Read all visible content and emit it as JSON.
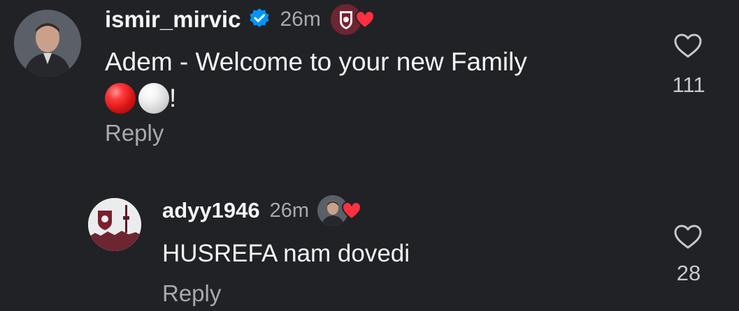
{
  "comments": [
    {
      "username": "ismir_mirvic",
      "time": "26m",
      "text_line1": "Adem - Welcome to your new Family",
      "text_line2_suffix": "!",
      "reply_label": "Reply",
      "like_count": "111"
    },
    {
      "username": "adyy1946",
      "time": "26m",
      "text_line1": "HUSREFA nam dovedi",
      "reply_label": "Reply",
      "like_count": "28"
    }
  ],
  "colors": {
    "background": "#212226",
    "primary_text": "#f5f5f5",
    "secondary_text": "#a8a8ae",
    "verified_blue": "#0095f6",
    "heart_red": "#ff3040",
    "club_maroon": "#7a1f2b"
  },
  "icons": {
    "verified": "verified-badge-icon",
    "like": "heart-outline-icon",
    "liked_by_creator": "heart-filled-icon",
    "red_ball": "red-circle-emoji",
    "white_ball": "white-circle-emoji"
  }
}
